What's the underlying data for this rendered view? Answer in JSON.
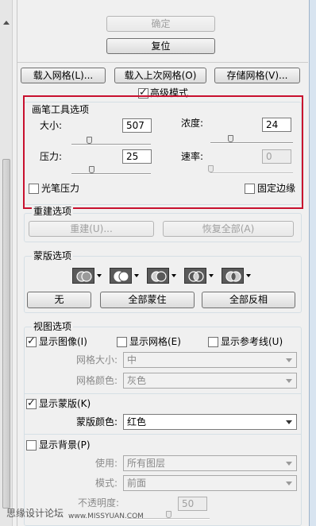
{
  "top_buttons": {
    "ok": "确定",
    "reset": "复位"
  },
  "mesh_buttons": {
    "load": "载入网格(L)...",
    "load_last": "载入上次网格(O)",
    "save": "存储网格(V)..."
  },
  "advanced_mode": {
    "label": "高级模式",
    "checked": true
  },
  "brush_options": {
    "title": "画笔工具选项",
    "size_label": "大小:",
    "size_value": "507",
    "size_level": 0.22,
    "density_label": "浓度:",
    "density_value": "24",
    "density_level": 0.24,
    "pressure_label": "压力:",
    "pressure_value": "25",
    "pressure_level": 0.25,
    "rate_label": "速率:",
    "rate_value": "0",
    "rate_level": 0,
    "stylus_pressure": "光笔压力",
    "pin_edges": "固定边缘",
    "highlight_color": "#c8102e"
  },
  "reconstruct": {
    "title": "重建选项",
    "rebuild": "重建(U)...",
    "restore_all": "恢复全部(A)"
  },
  "mask": {
    "title": "蒙版选项",
    "icons": [
      "mask-replace-icon",
      "mask-add-icon",
      "mask-subtract-icon",
      "mask-intersect-icon",
      "mask-invert-icon"
    ],
    "none": "无",
    "mask_all": "全部蒙住",
    "invert_all": "全部反相"
  },
  "view": {
    "title": "视图选项",
    "show_image": "显示图像(I)",
    "show_image_checked": true,
    "show_mesh": "显示网格(E)",
    "show_mesh_checked": false,
    "show_guides": "显示参考线(U)",
    "show_guides_checked": false,
    "mesh_size_label": "网格大小:",
    "mesh_size_value": "中",
    "mesh_color_label": "网格颜色:",
    "mesh_color_value": "灰色",
    "show_mask": "显示蒙版(K)",
    "show_mask_checked": true,
    "mask_color_label": "蒙版颜色:",
    "mask_color_value": "红色",
    "show_backdrop": "显示背景(P)",
    "show_backdrop_checked": false,
    "use_label": "使用:",
    "use_value": "所有图层",
    "mode_label": "模式:",
    "mode_value": "前面",
    "opacity_label": "不透明度:",
    "opacity_value": "50",
    "opacity_level": 0.5
  },
  "watermark": {
    "left": "思缘设计论坛",
    "right": "www.MISSYUAN.COM"
  }
}
